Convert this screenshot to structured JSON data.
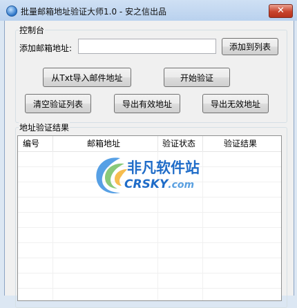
{
  "window": {
    "title": "批量邮箱地址验证大师1.0 - 安之信出品",
    "close_glyph": "✕"
  },
  "console": {
    "group_title": "控制台",
    "add_email_label": "添加邮箱地址:",
    "add_email_value": "",
    "add_to_list_button": "添加到列表",
    "import_txt_button": "从Txt导入邮件地址",
    "start_verify_button": "开始验证",
    "clear_list_button": "清空验证列表",
    "export_valid_button": "导出有效地址",
    "export_invalid_button": "导出无效地址"
  },
  "results": {
    "group_title": "地址验证结果",
    "columns": [
      "编号",
      "邮箱地址",
      "验证状态",
      "验证结果"
    ],
    "rows": []
  },
  "watermark": {
    "cn_text": "非凡软件站",
    "en_text": "CRSKY",
    "domain_suffix": ".com"
  },
  "colors": {
    "accent": "#2f6fb8",
    "close_button": "#c8432c",
    "watermark_blue": "#1f6cc8"
  }
}
